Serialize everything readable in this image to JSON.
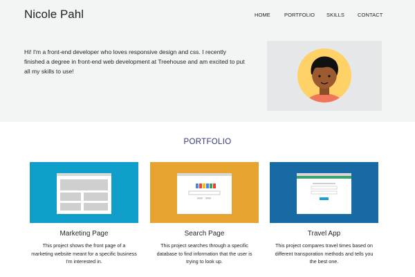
{
  "header": {
    "site_name": "Nicole Pahl",
    "nav": [
      "HOME",
      "PORTFOLIO",
      "SKILLS",
      "CONTACT"
    ]
  },
  "intro": {
    "text": "Hi! I'm a front-end developer who loves responsive design and css. I recently finished a degree in front-end web development at Treehouse and am excited to put all my skills to use!"
  },
  "portfolio": {
    "title": "PORTFOLIO",
    "cards": [
      {
        "title": "Marketing Page",
        "description": "This project shows the front page of a marketing website meant for a specific business I'm interested in.",
        "color": "#0f9dc9"
      },
      {
        "title": "Search Page",
        "description": "This project searches through a specific database to find information that the user is trying to look up.",
        "color": "#e7a32f"
      },
      {
        "title": "Travel App",
        "description": "This project compares travel times based on different transporation methods and tells you the best one.",
        "color": "#176aa4"
      }
    ]
  },
  "colors": {
    "hero_bg": "#f3f4f4",
    "accent": "#35357d",
    "avatar_bg": "#ffd166",
    "avatar_shirt": "#f07659",
    "avatar_skin": "#9c5a30"
  }
}
